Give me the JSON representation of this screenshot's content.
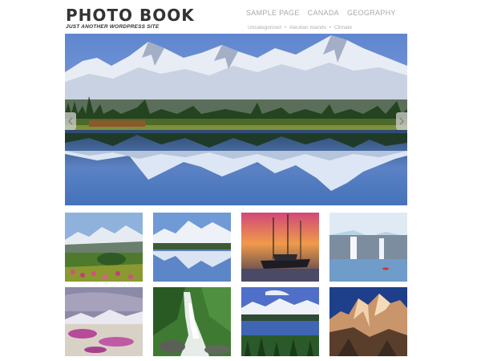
{
  "header": {
    "site_title": "PHOTO BOOK",
    "tagline": "JUST ANOTHER WORDPRESS SITE"
  },
  "main_nav": [
    {
      "label": "SAMPLE PAGE"
    },
    {
      "label": "CANADA"
    },
    {
      "label": "GEOGRAPHY"
    }
  ],
  "sub_nav": [
    {
      "label": "Uncategorized"
    },
    {
      "label": "Aleutian Islands"
    },
    {
      "label": "Climate"
    }
  ],
  "sub_nav_separator": "•",
  "slider": {
    "image_subject": "snow-capped-mountains-lake-reflection",
    "prev_icon": "chevron-left-icon",
    "next_icon": "chevron-right-icon"
  },
  "gallery": [
    {
      "subject": "alpine-meadow-wildflowers"
    },
    {
      "subject": "snowy-peaks-lake-reflection"
    },
    {
      "subject": "sunset-harbor-boats"
    },
    {
      "subject": "glacier-waterfalls"
    },
    {
      "subject": "purple-flowers-mountains"
    },
    {
      "subject": "forest-stream"
    },
    {
      "subject": "mountain-lake-forest"
    },
    {
      "subject": "rocky-peaks-golden-light"
    }
  ],
  "colors": {
    "title_text": "#333333",
    "nav_text": "#aaaaaa",
    "sky_blue": "#6a8fd0",
    "lake_blue": "#4a78c0"
  }
}
